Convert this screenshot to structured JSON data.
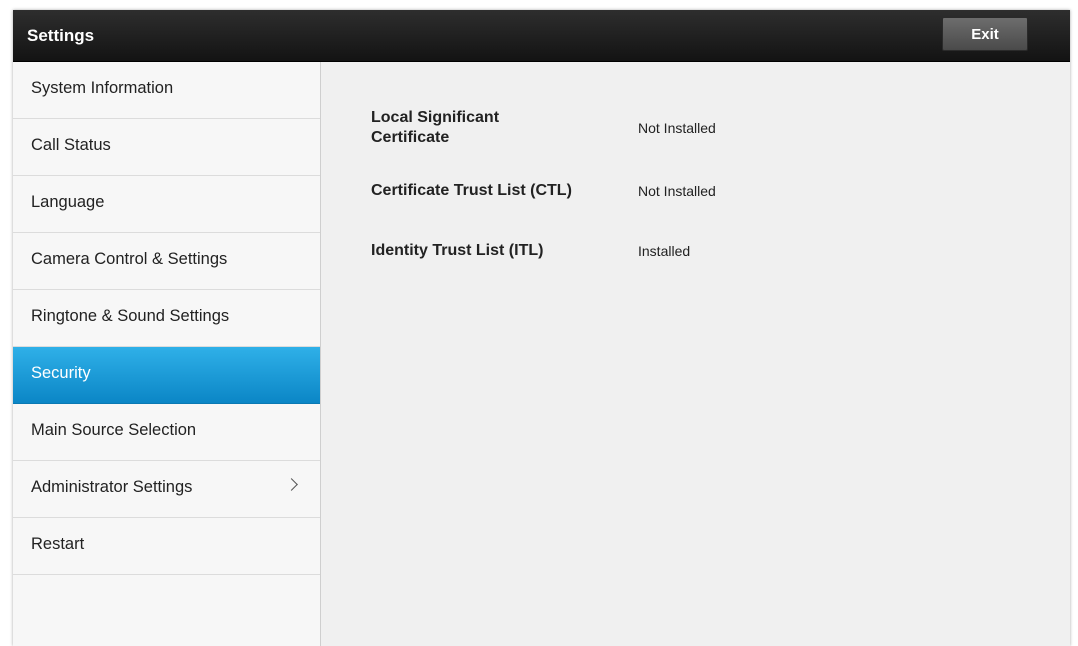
{
  "header": {
    "title": "Settings",
    "exit_label": "Exit"
  },
  "sidebar": {
    "items": [
      {
        "label": "System Information"
      },
      {
        "label": "Call Status"
      },
      {
        "label": "Language"
      },
      {
        "label": "Camera Control & Settings"
      },
      {
        "label": "Ringtone & Sound Settings"
      },
      {
        "label": "Security",
        "selected": true
      },
      {
        "label": "Main Source Selection"
      },
      {
        "label": "Administrator Settings",
        "has_submenu": true,
        "icon": "chevron-right-icon"
      },
      {
        "label": "Restart"
      }
    ]
  },
  "security": {
    "rows": [
      {
        "label": "Local Significant Certificate",
        "value": "Not Installed"
      },
      {
        "label": "Certificate Trust List (CTL)",
        "value": "Not Installed"
      },
      {
        "label": "Identity Trust List (ITL)",
        "value": "Installed"
      }
    ]
  },
  "colors": {
    "selected_item": "#1a9ad6",
    "titlebar": "#1e1e1e"
  }
}
